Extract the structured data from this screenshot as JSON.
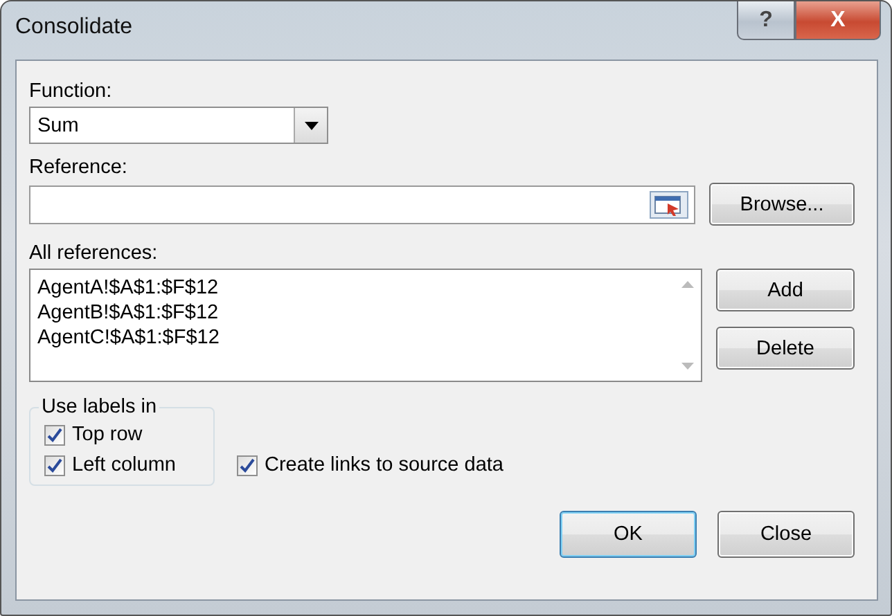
{
  "window": {
    "title": "Consolidate",
    "controls": [
      {
        "kind": "help",
        "label": "?"
      },
      {
        "kind": "close",
        "label": "X"
      }
    ]
  },
  "function": {
    "label": "Function:",
    "value": "Sum"
  },
  "reference": {
    "label": "Reference:",
    "browse": {
      "label": "Browse..."
    }
  },
  "all_references": {
    "label": "All references:",
    "items": [
      "AgentA!$A$1:$F$12",
      "AgentB!$A$1:$F$12",
      "AgentC!$A$1:$F$12"
    ],
    "buttons": [
      {
        "label": "Add",
        "disabled": false
      },
      {
        "label": "Delete",
        "disabled": false
      }
    ]
  },
  "use_labels": {
    "title": "Use labels in",
    "options": [
      {
        "label": "Top row",
        "checked": true
      },
      {
        "label": "Left column",
        "checked": true
      }
    ]
  },
  "create_links": {
    "label": "Create links to source data",
    "checked": true
  },
  "buttons": [
    {
      "label": "OK",
      "default": true
    },
    {
      "label": "Close",
      "default": false
    }
  ]
}
